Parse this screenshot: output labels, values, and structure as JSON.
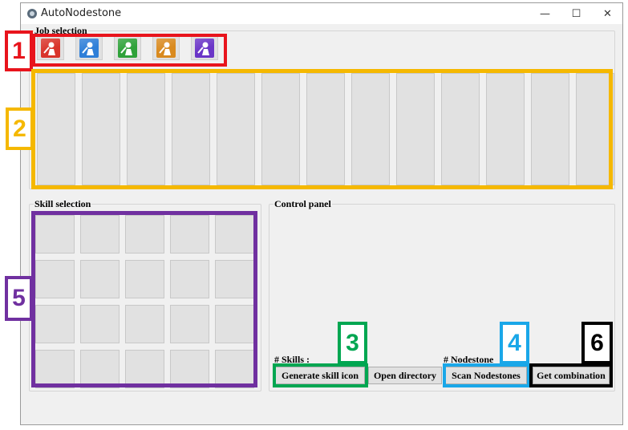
{
  "window": {
    "title": "AutoNodestone",
    "controls": {
      "minimize": "—",
      "maximize": "☐",
      "close": "✕"
    }
  },
  "job_selection": {
    "label": "Job selection",
    "jobs": [
      {
        "icon": "warrior-job-icon",
        "color": "#d9342b"
      },
      {
        "icon": "magician-job-icon",
        "color": "#2f7fd8"
      },
      {
        "icon": "bowman-job-icon",
        "color": "#2fa23a"
      },
      {
        "icon": "thief-job-icon",
        "color": "#d98a1f"
      },
      {
        "icon": "pirate-job-icon",
        "color": "#6a35c7"
      }
    ],
    "slot_count": 13
  },
  "skill_selection": {
    "label": "Skill selection",
    "rows": 4,
    "cols": 5
  },
  "control_panel": {
    "label": "Control panel",
    "skills_label": "# Skills :",
    "nodestones_label": "# Nodestone",
    "buttons": {
      "generate": "Generate skill icon",
      "open_dir": "Open directory",
      "scan": "Scan Nodestones",
      "combine": "Get combination"
    }
  },
  "annotations": [
    {
      "number": "1",
      "color": "#e8141c"
    },
    {
      "number": "2",
      "color": "#f5b800"
    },
    {
      "number": "3",
      "color": "#00a651"
    },
    {
      "number": "4",
      "color": "#1aa7e8"
    },
    {
      "number": "5",
      "color": "#7030a0"
    },
    {
      "number": "6",
      "color": "#000000"
    }
  ]
}
